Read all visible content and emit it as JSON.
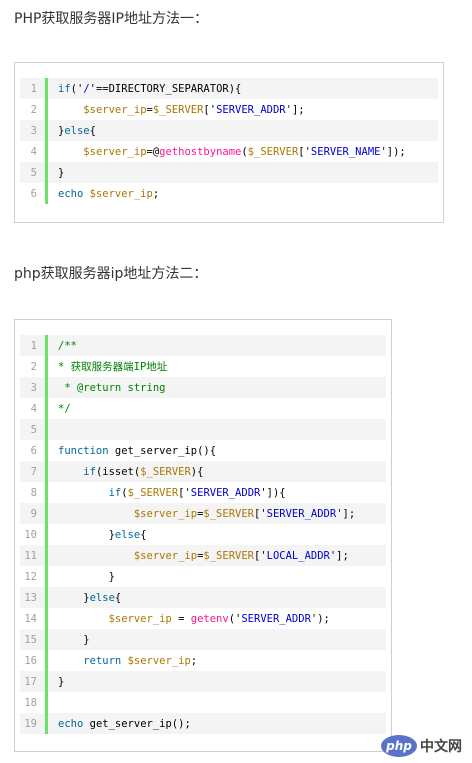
{
  "section1": {
    "heading": "PHP获取服务器IP地址方法一：",
    "lines": [
      {
        "n": "1",
        "tokens": [
          [
            "kw",
            "if"
          ],
          [
            "plain",
            "('"
          ],
          [
            "str",
            "/"
          ],
          [
            "plain",
            "'==DIRECTORY_SEPARATOR){"
          ]
        ]
      },
      {
        "n": "2",
        "tokens": [
          [
            "plain",
            "    "
          ],
          [
            "var",
            "$server_ip"
          ],
          [
            "plain",
            "="
          ],
          [
            "var",
            "$_SERVER"
          ],
          [
            "plain",
            "['"
          ],
          [
            "str",
            "SERVER_ADDR"
          ],
          [
            "plain",
            "'];"
          ]
        ]
      },
      {
        "n": "3",
        "tokens": [
          [
            "plain",
            "}"
          ],
          [
            "kw",
            "else"
          ],
          [
            "plain",
            "{"
          ]
        ]
      },
      {
        "n": "4",
        "tokens": [
          [
            "plain",
            "    "
          ],
          [
            "var",
            "$server_ip"
          ],
          [
            "plain",
            "=@"
          ],
          [
            "fn",
            "gethostbyname"
          ],
          [
            "plain",
            "("
          ],
          [
            "var",
            "$_SERVER"
          ],
          [
            "plain",
            "['"
          ],
          [
            "str",
            "SERVER_NAME"
          ],
          [
            "plain",
            "']);"
          ]
        ]
      },
      {
        "n": "5",
        "tokens": [
          [
            "plain",
            "}"
          ]
        ]
      },
      {
        "n": "6",
        "tokens": [
          [
            "kw",
            "echo "
          ],
          [
            "var",
            "$server_ip"
          ],
          [
            "plain",
            ";"
          ]
        ]
      }
    ]
  },
  "section2": {
    "heading": "php获取服务器ip地址方法二：",
    "lines": [
      {
        "n": "1",
        "tokens": [
          [
            "cmt",
            "/**"
          ]
        ]
      },
      {
        "n": "2",
        "tokens": [
          [
            "cmt",
            "* 获取服务器端IP地址"
          ]
        ]
      },
      {
        "n": "3",
        "tokens": [
          [
            "cmt",
            " * @return string"
          ]
        ]
      },
      {
        "n": "4",
        "tokens": [
          [
            "cmt",
            "*/"
          ]
        ]
      },
      {
        "n": "5",
        "tokens": []
      },
      {
        "n": "6",
        "tokens": [
          [
            "kw",
            "function"
          ],
          [
            "plain",
            " get_server_ip(){"
          ]
        ]
      },
      {
        "n": "7",
        "tokens": [
          [
            "plain",
            "    "
          ],
          [
            "kw",
            "if"
          ],
          [
            "plain",
            "(isset("
          ],
          [
            "var",
            "$_SERVER"
          ],
          [
            "plain",
            "){"
          ]
        ]
      },
      {
        "n": "8",
        "tokens": [
          [
            "plain",
            "        "
          ],
          [
            "kw",
            "if"
          ],
          [
            "plain",
            "("
          ],
          [
            "var",
            "$_SERVER"
          ],
          [
            "plain",
            "['"
          ],
          [
            "str",
            "SERVER_ADDR"
          ],
          [
            "plain",
            "']){"
          ]
        ]
      },
      {
        "n": "9",
        "tokens": [
          [
            "plain",
            "            "
          ],
          [
            "var",
            "$server_ip"
          ],
          [
            "plain",
            "="
          ],
          [
            "var",
            "$_SERVER"
          ],
          [
            "plain",
            "['"
          ],
          [
            "str",
            "SERVER_ADDR"
          ],
          [
            "plain",
            "'];"
          ]
        ]
      },
      {
        "n": "10",
        "tokens": [
          [
            "plain",
            "        }"
          ],
          [
            "kw",
            "else"
          ],
          [
            "plain",
            "{"
          ]
        ]
      },
      {
        "n": "11",
        "tokens": [
          [
            "plain",
            "            "
          ],
          [
            "var",
            "$server_ip"
          ],
          [
            "plain",
            "="
          ],
          [
            "var",
            "$_SERVER"
          ],
          [
            "plain",
            "['"
          ],
          [
            "str",
            "LOCAL_ADDR"
          ],
          [
            "plain",
            "'];"
          ]
        ]
      },
      {
        "n": "12",
        "tokens": [
          [
            "plain",
            "        }"
          ]
        ]
      },
      {
        "n": "13",
        "tokens": [
          [
            "plain",
            "    }"
          ],
          [
            "kw",
            "else"
          ],
          [
            "plain",
            "{"
          ]
        ]
      },
      {
        "n": "14",
        "tokens": [
          [
            "plain",
            "        "
          ],
          [
            "var",
            "$server_ip"
          ],
          [
            "plain",
            " = "
          ],
          [
            "fn",
            "getenv"
          ],
          [
            "plain",
            "('"
          ],
          [
            "str",
            "SERVER_ADDR"
          ],
          [
            "plain",
            "');"
          ]
        ]
      },
      {
        "n": "15",
        "tokens": [
          [
            "plain",
            "    }"
          ]
        ]
      },
      {
        "n": "16",
        "tokens": [
          [
            "plain",
            "    "
          ],
          [
            "kw",
            "return "
          ],
          [
            "var",
            "$server_ip"
          ],
          [
            "plain",
            ";"
          ]
        ]
      },
      {
        "n": "17",
        "tokens": [
          [
            "plain",
            "}"
          ]
        ]
      },
      {
        "n": "18",
        "tokens": []
      },
      {
        "n": "19",
        "tokens": [
          [
            "kw",
            "echo"
          ],
          [
            "plain",
            " get_server_ip();"
          ]
        ]
      }
    ]
  },
  "watermark": {
    "badge": "php",
    "text": "中文网"
  }
}
